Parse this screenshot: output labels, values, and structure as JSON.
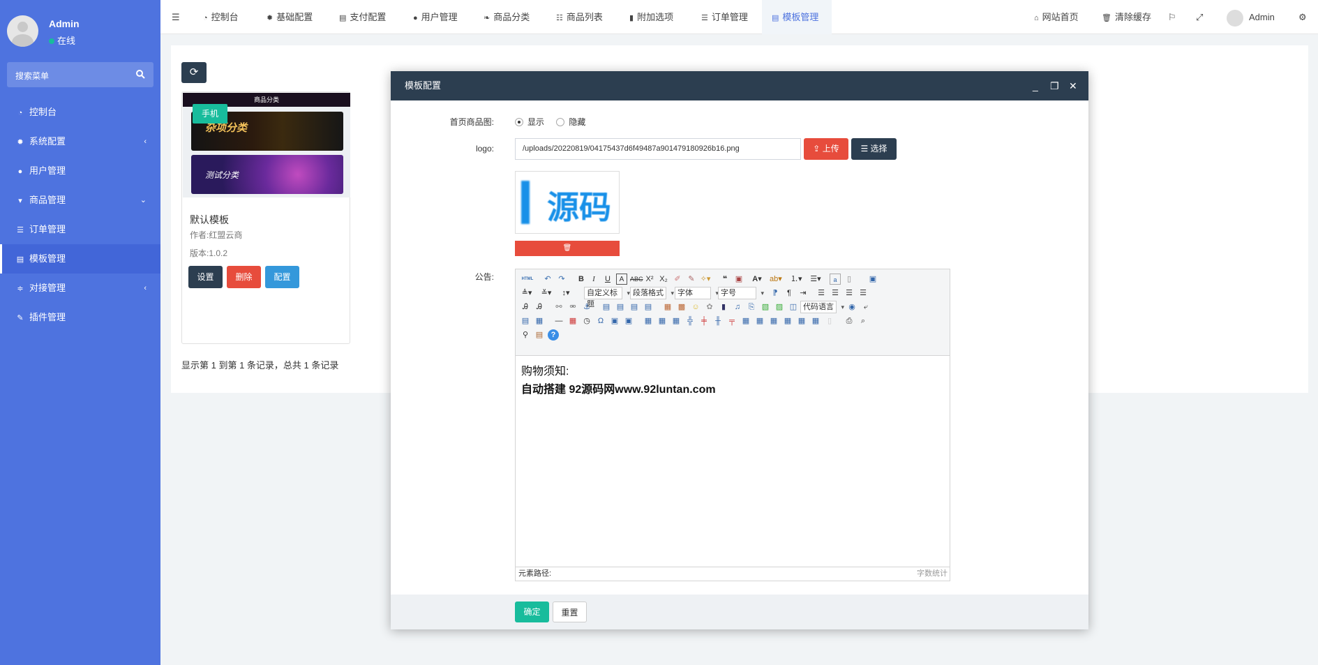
{
  "sidebar": {
    "user_name": "Admin",
    "user_status": "在线",
    "search_placeholder": "搜索菜单",
    "items": [
      {
        "label": "控制台",
        "icon": "dashboard-icon"
      },
      {
        "label": "系统配置",
        "icon": "gear-icon"
      },
      {
        "label": "用户管理",
        "icon": "user-icon"
      },
      {
        "label": "商品管理",
        "icon": "cart-icon"
      },
      {
        "label": "订单管理",
        "icon": "list-icon"
      },
      {
        "label": "模板管理",
        "icon": "template-icon"
      },
      {
        "label": "对接管理",
        "icon": "sliders-icon"
      },
      {
        "label": "插件管理",
        "icon": "plugin-icon"
      }
    ]
  },
  "topbar": {
    "tabs": [
      "控制台",
      "基础配置",
      "支付配置",
      "用户管理",
      "商品分类",
      "商品列表",
      "附加选项",
      "订单管理",
      "模板管理"
    ],
    "right": {
      "home": "网站首页",
      "clear_cache": "清除缓存",
      "user": "Admin"
    }
  },
  "panel": {
    "template": {
      "badge": "手机",
      "thumb_header": "商品分类",
      "thumb_cat1": "杂项分类",
      "thumb_cat2": "测试分类",
      "name": "默认模板",
      "author": "作者:红盟云商",
      "version": "版本:1.0.2",
      "btn_settings": "设置",
      "btn_delete": "删除",
      "btn_config": "配置"
    },
    "records": "显示第 1 到第 1 条记录，总共 1 条记录"
  },
  "modal": {
    "title": "模板配置",
    "field_home_image": "首页商品图:",
    "opt_show": "显示",
    "opt_hide": "隐藏",
    "field_logo": "logo:",
    "logo_value": "/uploads/20220819/04175437d6f49487a901479180926b16.png",
    "btn_upload": "上传",
    "btn_choose": "选择",
    "logo_preview_text": "源码",
    "field_notice": "公告:",
    "toolbar_selects": {
      "heading": "自定义标题",
      "paragraph": "段落格式",
      "font": "字体",
      "size": "字号",
      "code": "代码语言"
    },
    "toolbar_html": "HTML",
    "content_line1": "购物须知:",
    "content_line2": "自动搭建 92源码网www.92luntan.com",
    "status_path": "元素路径:",
    "status_count": "字数统计",
    "btn_ok": "确定",
    "btn_reset": "重置"
  }
}
